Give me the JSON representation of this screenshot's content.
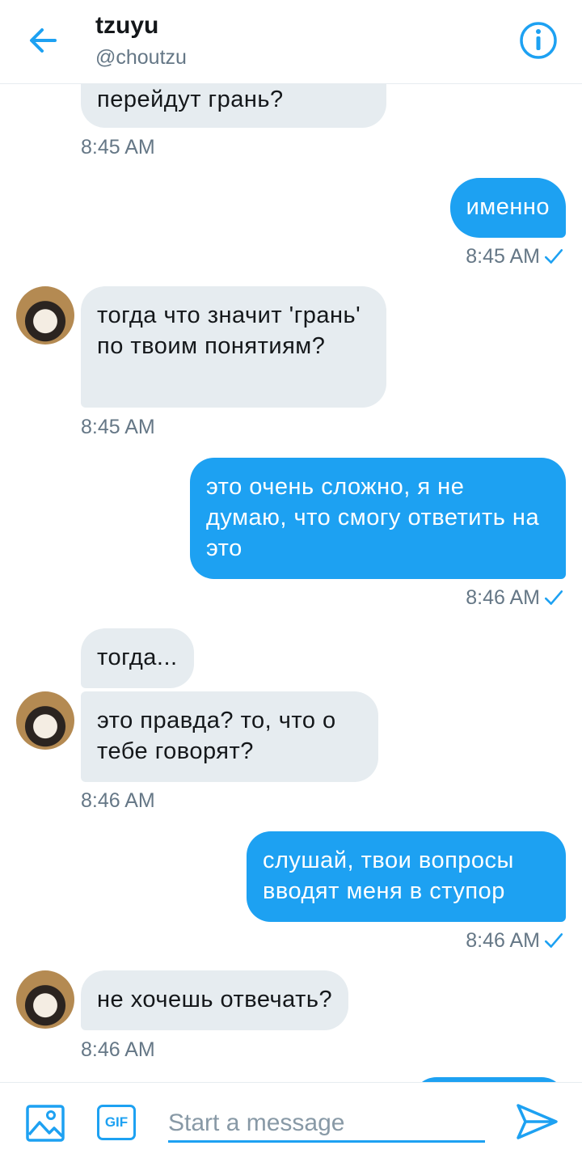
{
  "header": {
    "title": "tzuyu",
    "handle": "@choutzu",
    "back_icon": "arrow-left-icon",
    "info_icon": "info-icon"
  },
  "messages": [
    {
      "direction": "in",
      "text": "перейдут грань?",
      "time": "8:45 AM"
    },
    {
      "direction": "out",
      "text": "именно",
      "time": "8:45 AM",
      "status": "read"
    },
    {
      "direction": "in",
      "text": "тогда что значит 'грань' по твоим понятиям?",
      "time": "8:45 AM"
    },
    {
      "direction": "out",
      "text": "это очень сложно, я не думаю, что смогу ответить на это",
      "time": "8:46 AM",
      "status": "read"
    },
    {
      "direction": "in",
      "text": "тогда..."
    },
    {
      "direction": "in",
      "text": "это правда? то, что о тебе говорят?",
      "time": "8:46 AM"
    },
    {
      "direction": "out",
      "text": "слушай, твои вопросы вводят меня в ступор",
      "time": "8:46 AM",
      "status": "read"
    },
    {
      "direction": "in",
      "text": "не хочешь отвечать?",
      "time": "8:46 AM"
    }
  ],
  "composer": {
    "placeholder": "Start a message",
    "gif_label": "GIF",
    "photo_icon": "image-icon",
    "send_icon": "send-icon"
  },
  "colors": {
    "accent": "#1da1f2",
    "incoming_bubble": "#e6ecf0",
    "secondary_text": "#657786"
  }
}
